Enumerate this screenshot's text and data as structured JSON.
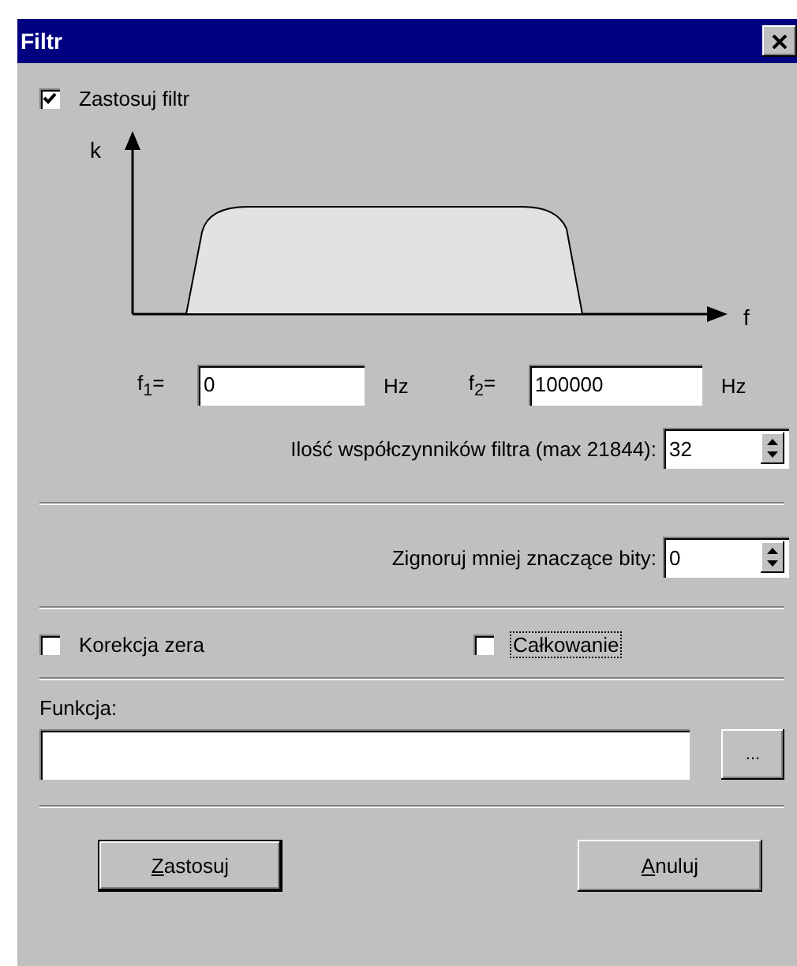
{
  "window": {
    "title": "Filtr"
  },
  "apply_filter": {
    "label": "Zastosuj filtr",
    "checked": true
  },
  "graph": {
    "y_label": "k",
    "x_label": "f"
  },
  "frequencies": [
    {
      "label": "f$_{1}$=",
      "value": "0",
      "unit": "Hz"
    },
    {
      "label": "f$_{2}$=",
      "value": "100000",
      "unit": "Hz"
    }
  ],
  "spinners": [
    {
      "label": "Ilość współczynników filtra (max 21844):",
      "value": "32"
    },
    {
      "label": "Zignoruj mniej znaczące bity:",
      "value": "0"
    }
  ],
  "options": [
    {
      "label": "Korekcja zera",
      "checked": false,
      "focused": false
    },
    {
      "label": "Całkowanie",
      "checked": false,
      "focused": true
    }
  ],
  "function": {
    "label": "Funkcja:",
    "browse": "..."
  },
  "buttons": [
    {
      "label": "Zastosuj",
      "underline_first": true,
      "default": true
    },
    {
      "label": "Anuluj",
      "underline_first": true,
      "default": false
    }
  ]
}
